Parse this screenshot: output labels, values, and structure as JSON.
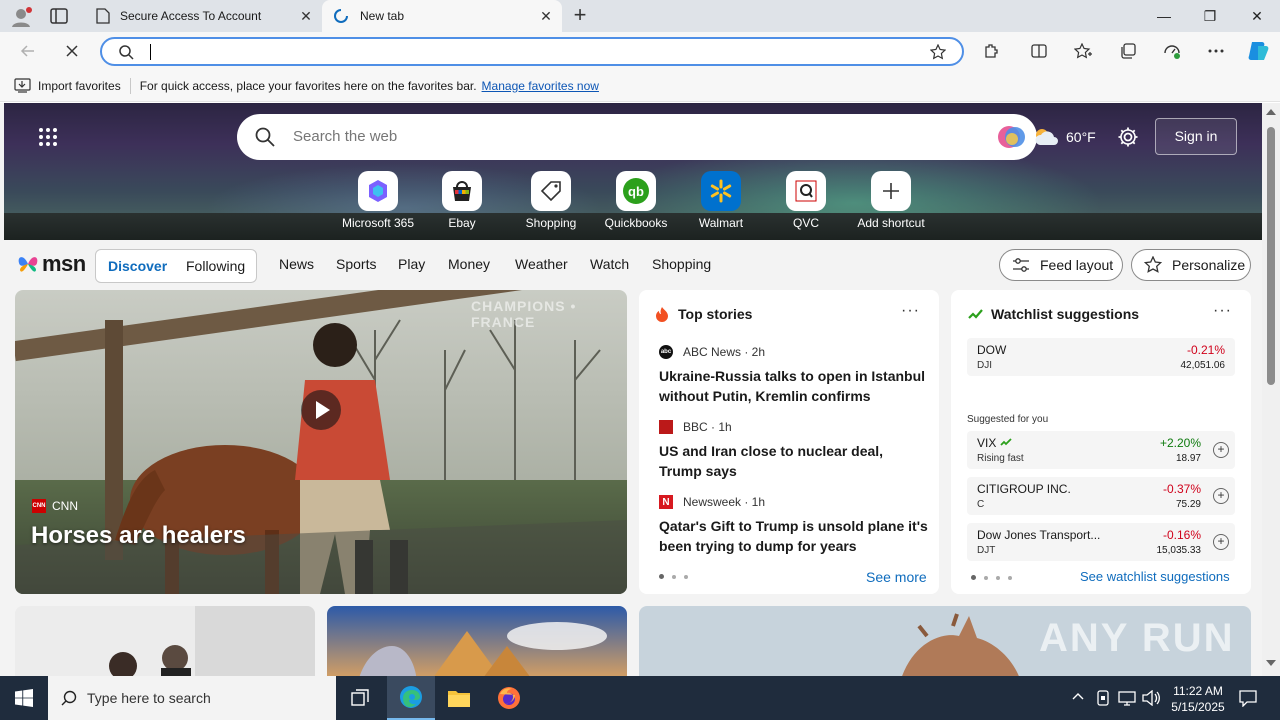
{
  "tabs": [
    {
      "title": "Secure Access To Account",
      "close": "✕"
    },
    {
      "title": "New tab",
      "close": "✕"
    }
  ],
  "new_tab_symbol": "+",
  "window_controls": {
    "minimize": "—",
    "restore": "❐",
    "close": "✕"
  },
  "toolbar": {
    "address_value": "",
    "icons": [
      "back-arrow-icon",
      "stop-icon",
      "search-icon",
      "star-icon",
      "extensions-icon",
      "split-screen-icon",
      "favorites-icon",
      "collections-icon",
      "performance-icon",
      "more-icon",
      "copilot-icon"
    ]
  },
  "favorites_bar": {
    "import_label": "Import favorites",
    "message": "For quick access, place your favorites here on the favorites bar.",
    "manage_link": "Manage favorites now"
  },
  "hero": {
    "search_placeholder": "Search the web",
    "weather_temp": "60°F",
    "signin_label": "Sign in",
    "shortcuts": [
      {
        "label": "Microsoft 365",
        "icon": "microsoft365-icon"
      },
      {
        "label": "Ebay",
        "icon": "ebay-icon"
      },
      {
        "label": "Shopping",
        "icon": "shopping-tag-icon"
      },
      {
        "label": "Quickbooks",
        "icon": "quickbooks-icon"
      },
      {
        "label": "Walmart",
        "icon": "walmart-icon"
      },
      {
        "label": "QVC",
        "icon": "qvc-icon"
      },
      {
        "label": "Add shortcut",
        "icon": "plus-icon"
      }
    ]
  },
  "msn_nav": {
    "logo": "msn",
    "tabs": [
      "Discover",
      "Following"
    ],
    "items": [
      "News",
      "Sports",
      "Play",
      "Money",
      "Weather",
      "Watch",
      "Shopping"
    ],
    "feed_layout_label": "Feed layout",
    "personalize_label": "Personalize"
  },
  "featured": {
    "source": "CNN",
    "headline": "Horses are healers",
    "watermark": "CHAMPIONS • FRANCE"
  },
  "top_stories": {
    "title": "Top stories",
    "stories": [
      {
        "source": "ABC News · 2h",
        "headline": "Ukraine-Russia talks to open in Istanbul without Putin, Kremlin confirms"
      },
      {
        "source": "BBC · 1h",
        "headline": "US and Iran close to nuclear deal, Trump says"
      },
      {
        "source": "Newsweek · 1h",
        "headline": "Qatar's Gift to Trump is unsold plane it's been trying to dump for years"
      }
    ],
    "see_more": "See more"
  },
  "watchlist": {
    "title": "Watchlist suggestions",
    "pinned": {
      "name": "DOW",
      "ticker": "DJI",
      "change": "-0.21%",
      "value": "42,051.06"
    },
    "suggested_label": "Suggested for you",
    "suggestions": [
      {
        "name": "VIX",
        "ticker": "Rising fast",
        "change": "+2.20%",
        "value": "18.97"
      },
      {
        "name": "CITIGROUP INC.",
        "ticker": "C",
        "change": "-0.37%",
        "value": "75.29"
      },
      {
        "name": "Dow Jones Transport...",
        "ticker": "DJT",
        "change": "-0.16%",
        "value": "15,035.33"
      }
    ],
    "see_link": "See watchlist suggestions"
  },
  "watermark": "ANY RUN",
  "taskbar": {
    "search_placeholder": "Type here to search",
    "time": "11:22 AM",
    "date": "5/15/2025"
  },
  "colors": {
    "accent": "#0f6cbd",
    "negative": "#d0021b",
    "positive": "#0f7b0f",
    "taskbar": "#1f2c3d"
  }
}
